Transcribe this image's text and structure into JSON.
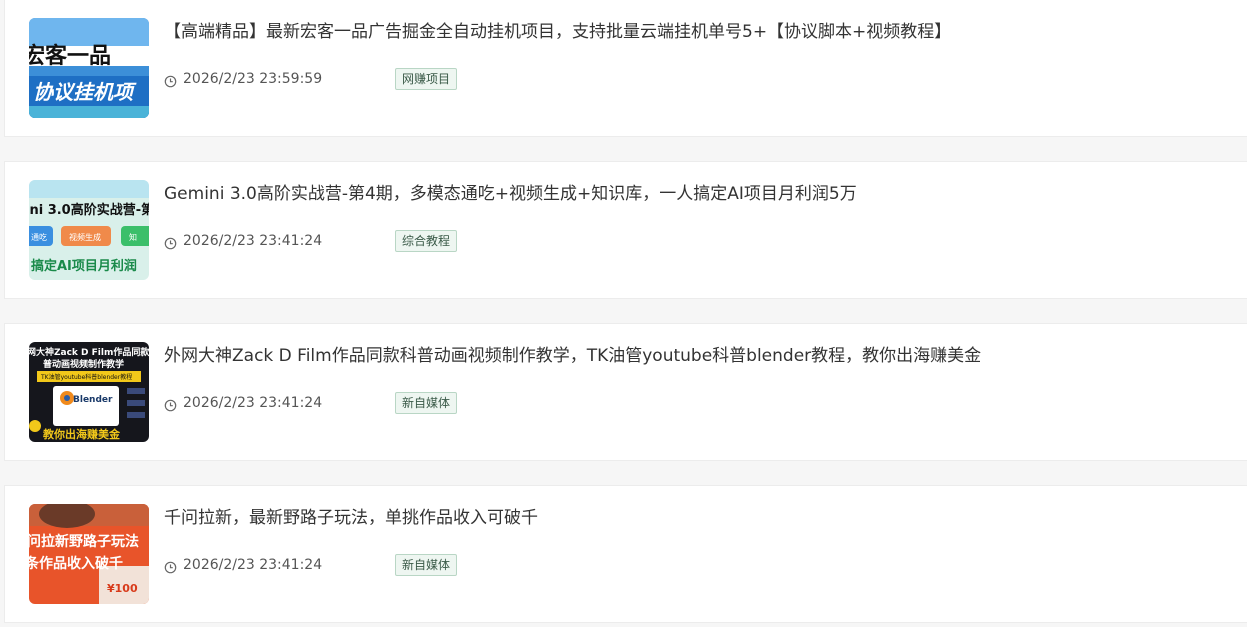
{
  "articles": [
    {
      "title": "【高端精品】最新宏客一品广告掘金全自动挂机项目，支持批量云端挂机单号5+【协议脚本+视频教程】",
      "date": "2026/2/23 23:59:59",
      "tag": "网赚项目",
      "thumb": {
        "line1": "宏客一品",
        "line2": "协议挂机项"
      }
    },
    {
      "title": "Gemini 3.0高阶实战营-第4期，多模态通吃+视频生成+知识库，一人搞定AI项目月利润5万",
      "date": "2026/2/23 23:41:24",
      "tag": "综合教程",
      "thumb": {
        "line1": "ini 3.0高阶实战营-第",
        "b1": "通吃",
        "b2": "视频生成",
        "b3": "知",
        "line2": "搞定AI项目月利润"
      }
    },
    {
      "title": "外网大神Zack D Film作品同款科普动画视频制作教学，TK油管youtube科普blender教程，教你出海赚美金",
      "date": "2026/2/23 23:41:24",
      "tag": "新自媒体",
      "thumb": {
        "line1": "网大神Zack D Film作品同款",
        "line2": "普动画视频制作教学",
        "line3": "TK油管youtube科普blender教程",
        "logo": "Blender",
        "line4": "教你出海赚美金"
      }
    },
    {
      "title": "千问拉新，最新野路子玩法，单挑作品收入可破千",
      "date": "2026/2/23 23:41:24",
      "tag": "新自媒体",
      "thumb": {
        "line1": "问拉新野路子玩法",
        "line2": "条作品收入破千",
        "amount": "¥100"
      }
    }
  ]
}
